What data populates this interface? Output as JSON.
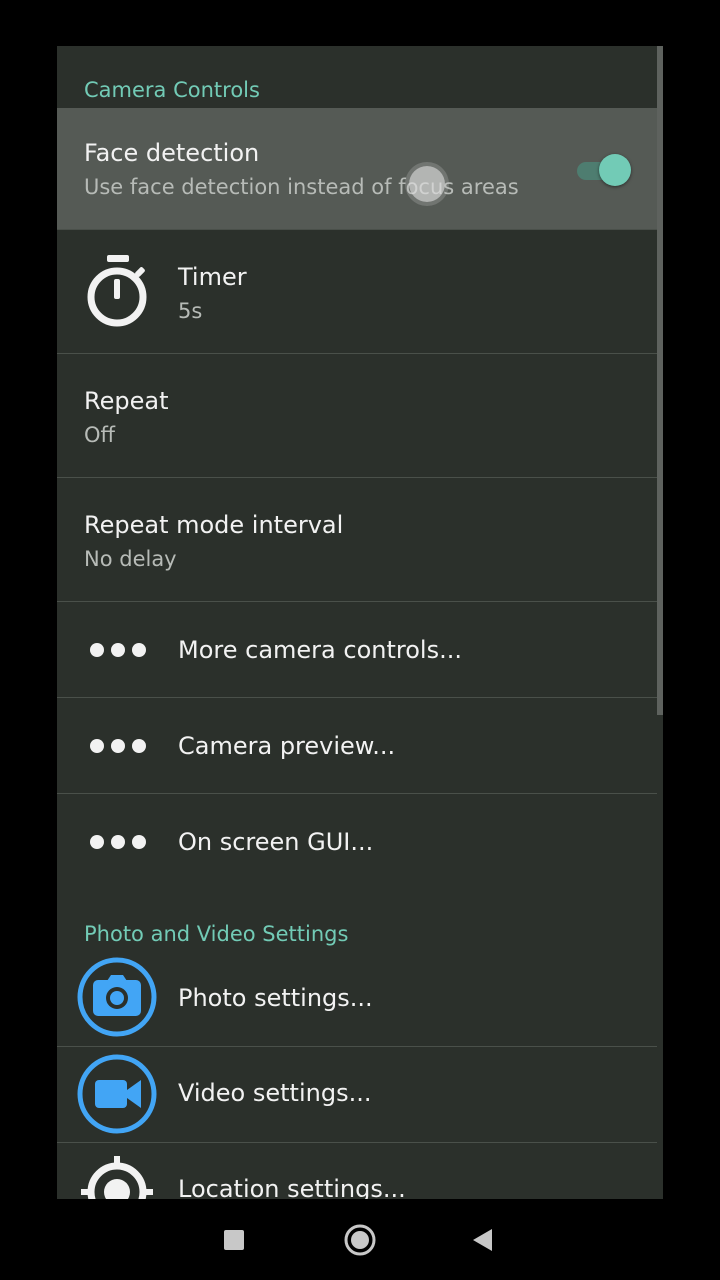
{
  "sections": {
    "camera_controls": "Camera Controls",
    "photo_video": "Photo and Video Settings"
  },
  "items": {
    "face_detection": {
      "title": "Face detection",
      "subtitle": "Use face detection instead of focus areas",
      "toggle_on": true
    },
    "timer": {
      "title": "Timer",
      "value": "5s",
      "icon": "stopwatch-icon"
    },
    "repeat": {
      "title": "Repeat",
      "value": "Off"
    },
    "repeat_interval": {
      "title": "Repeat mode interval",
      "value": "No delay"
    },
    "more_controls": {
      "title": "More camera controls...",
      "icon": "more-dots-icon"
    },
    "camera_preview": {
      "title": "Camera preview...",
      "icon": "more-dots-icon"
    },
    "on_screen_gui": {
      "title": "On screen GUI...",
      "icon": "more-dots-icon"
    },
    "photo_settings": {
      "title": "Photo settings...",
      "icon": "camera-icon"
    },
    "video_settings": {
      "title": "Video settings...",
      "icon": "video-camera-icon"
    },
    "location_settings": {
      "title": "Location settings...",
      "icon": "location-crosshair-icon"
    }
  },
  "colors": {
    "accent": "#72cbb6",
    "background": "#2b302b",
    "icon_blue": "#42a5f5"
  },
  "navbar": {
    "recents": "recents-square-icon",
    "home": "home-circle-icon",
    "back": "back-triangle-icon"
  }
}
